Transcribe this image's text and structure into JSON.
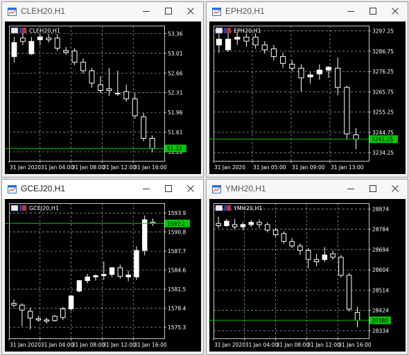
{
  "windows": [
    {
      "title": "CLEH20,H1",
      "active": false,
      "chart_label": "CLEH20,H1",
      "chart_data": {
        "type": "candlestick",
        "symbol": "CLEH20",
        "timeframe": "H1",
        "y_ticks": [
          "53.36",
          "53.01",
          "52.66",
          "52.31",
          "51.96",
          "51.61",
          "51.26"
        ],
        "ylim": [
          51.1,
          53.5
        ],
        "x_labels": [
          "31 Jan 2020",
          "31 Jan 04:00",
          "31 Jan 08:00",
          "31 Jan 12:00",
          "31 Jan 16:00"
        ],
        "current_price": "51.32",
        "candles": [
          {
            "o": 52.95,
            "h": 53.3,
            "l": 52.85,
            "c": 53.2
          },
          {
            "o": 53.28,
            "h": 53.38,
            "l": 53.15,
            "c": 53.22
          },
          {
            "o": 53.0,
            "h": 53.3,
            "l": 52.98,
            "c": 53.22
          },
          {
            "o": 53.25,
            "h": 53.36,
            "l": 53.15,
            "c": 53.3
          },
          {
            "o": 53.28,
            "h": 53.35,
            "l": 53.2,
            "c": 53.25
          },
          {
            "o": 53.28,
            "h": 53.35,
            "l": 53.05,
            "c": 53.1
          },
          {
            "o": 53.06,
            "h": 53.12,
            "l": 52.98,
            "c": 53.03
          },
          {
            "o": 53.05,
            "h": 53.1,
            "l": 52.8,
            "c": 52.85
          },
          {
            "o": 52.85,
            "h": 52.92,
            "l": 52.65,
            "c": 52.7
          },
          {
            "o": 52.7,
            "h": 52.75,
            "l": 52.4,
            "c": 52.48
          },
          {
            "o": 52.45,
            "h": 52.6,
            "l": 52.3,
            "c": 52.35
          },
          {
            "o": 52.38,
            "h": 52.75,
            "l": 52.25,
            "c": 52.35
          },
          {
            "o": 52.3,
            "h": 52.7,
            "l": 52.25,
            "c": 52.3
          },
          {
            "o": 52.33,
            "h": 52.45,
            "l": 52.15,
            "c": 52.2
          },
          {
            "o": 52.2,
            "h": 52.3,
            "l": 51.85,
            "c": 51.9
          },
          {
            "o": 51.88,
            "h": 51.95,
            "l": 51.45,
            "c": 51.5
          },
          {
            "o": 51.5,
            "h": 51.55,
            "l": 51.25,
            "c": 51.32
          }
        ]
      }
    },
    {
      "title": "EPH20,H1",
      "active": false,
      "chart_label": "EPH20,H1",
      "chart_data": {
        "type": "candlestick",
        "symbol": "EPH20",
        "timeframe": "H1",
        "y_ticks": [
          "3297.25",
          "3286.75",
          "3276.25",
          "3265.75",
          "3255.25",
          "3244.75",
          "3234.25"
        ],
        "ylim": [
          3230,
          3300
        ],
        "x_labels": [
          "31 Jan 2020",
          "31 Jan 05:00",
          "31 Jan 09:00",
          "31 Jan 13:00"
        ],
        "current_price": "3241.25",
        "candles": [
          {
            "o": 3290.0,
            "h": 3296.0,
            "l": 3286.0,
            "c": 3293.0
          },
          {
            "o": 3287.5,
            "h": 3296.0,
            "l": 3286.5,
            "c": 3293.0
          },
          {
            "o": 3293.0,
            "h": 3296.5,
            "l": 3290.0,
            "c": 3294.0
          },
          {
            "o": 3294.0,
            "h": 3296.0,
            "l": 3289.0,
            "c": 3292.0
          },
          {
            "o": 3294.0,
            "h": 3296.0,
            "l": 3288.0,
            "c": 3290.0
          },
          {
            "o": 3290.0,
            "h": 3292.0,
            "l": 3285.5,
            "c": 3287.5
          },
          {
            "o": 3288.0,
            "h": 3290.0,
            "l": 3282.0,
            "c": 3284.0
          },
          {
            "o": 3284.0,
            "h": 3286.0,
            "l": 3278.0,
            "c": 3280.5
          },
          {
            "o": 3280.0,
            "h": 3282.0,
            "l": 3276.5,
            "c": 3278.0
          },
          {
            "o": 3278.0,
            "h": 3280.0,
            "l": 3266.0,
            "c": 3273.0
          },
          {
            "o": 3273.5,
            "h": 3276.0,
            "l": 3270.0,
            "c": 3274.5
          },
          {
            "o": 3275.0,
            "h": 3280.0,
            "l": 3272.0,
            "c": 3277.0
          },
          {
            "o": 3277.0,
            "h": 3279.0,
            "l": 3273.0,
            "c": 3278.5
          },
          {
            "o": 3278.0,
            "h": 3283.5,
            "l": 3264.0,
            "c": 3268.0
          },
          {
            "o": 3268.0,
            "h": 3269.0,
            "l": 3241.0,
            "c": 3244.0
          },
          {
            "o": 3243.5,
            "h": 3247.0,
            "l": 3236.0,
            "c": 3241.25
          }
        ]
      }
    },
    {
      "title": "GCEJ20,H1",
      "active": true,
      "chart_label": "GCEJ20,H1",
      "chart_data": {
        "type": "candlestick",
        "symbol": "GCEJ20",
        "timeframe": "H1",
        "y_ticks": [
          "1593.9",
          "1590.8",
          "1587.7",
          "1584.6",
          "1581.5",
          "1578.4",
          "1575.3"
        ],
        "ylim": [
          1573.5,
          1595.5
        ],
        "x_labels": [
          "31 Jan 2020",
          "31 Jan 04:00",
          "31 Jan 08:00",
          "31 Jan 12:00",
          "31 Jan 16:00"
        ],
        "current_price": "1592.2",
        "candles": [
          {
            "o": 1579.2,
            "h": 1579.8,
            "l": 1578.6,
            "c": 1578.9
          },
          {
            "o": 1578.9,
            "h": 1579.2,
            "l": 1575.5,
            "c": 1578.1
          },
          {
            "o": 1577.9,
            "h": 1578.5,
            "l": 1575.0,
            "c": 1576.8
          },
          {
            "o": 1576.7,
            "h": 1577.1,
            "l": 1576.2,
            "c": 1576.5
          },
          {
            "o": 1576.5,
            "h": 1576.9,
            "l": 1575.9,
            "c": 1576.3
          },
          {
            "o": 1577.1,
            "h": 1577.3,
            "l": 1576.2,
            "c": 1576.4
          },
          {
            "o": 1578.3,
            "h": 1578.6,
            "l": 1576.5,
            "c": 1576.9
          },
          {
            "o": 1578.3,
            "h": 1580.5,
            "l": 1578.0,
            "c": 1580.4
          },
          {
            "o": 1581.2,
            "h": 1583.0,
            "l": 1581.0,
            "c": 1582.9
          },
          {
            "o": 1582.9,
            "h": 1584.0,
            "l": 1582.5,
            "c": 1583.5
          },
          {
            "o": 1583.5,
            "h": 1583.9,
            "l": 1582.9,
            "c": 1583.7
          },
          {
            "o": 1583.7,
            "h": 1586.0,
            "l": 1583.0,
            "c": 1583.9
          },
          {
            "o": 1583.9,
            "h": 1584.5,
            "l": 1583.5,
            "c": 1585.0
          },
          {
            "o": 1585.0,
            "h": 1585.5,
            "l": 1583.2,
            "c": 1583.6
          },
          {
            "o": 1583.5,
            "h": 1584.5,
            "l": 1582.8,
            "c": 1583.8
          },
          {
            "o": 1583.5,
            "h": 1588.5,
            "l": 1583.0,
            "c": 1587.8
          },
          {
            "o": 1587.8,
            "h": 1593.5,
            "l": 1587.0,
            "c": 1592.8
          },
          {
            "o": 1592.4,
            "h": 1593.0,
            "l": 1591.8,
            "c": 1592.2
          }
        ]
      }
    },
    {
      "title": "YMH20,H1",
      "active": false,
      "chart_label": "YMH20,H1",
      "chart_data": {
        "type": "candlestick",
        "symbol": "YMH20",
        "timeframe": "H1",
        "y_ticks": [
          "28874",
          "28784",
          "28694",
          "28604",
          "28514",
          "28424",
          "28334"
        ],
        "ylim": [
          28300,
          28900
        ],
        "x_labels": [
          "31 Jan 2020",
          "31 Jan 04:00",
          "31 Jan 08:00",
          "31 Jan 12:00",
          "31 Jan 16:00"
        ],
        "current_price": "28380",
        "candles": [
          {
            "o": 28810,
            "h": 28840,
            "l": 28790,
            "c": 28800
          },
          {
            "o": 28800,
            "h": 28830,
            "l": 28795,
            "c": 28820
          },
          {
            "o": 28805,
            "h": 28830,
            "l": 28785,
            "c": 28795
          },
          {
            "o": 28795,
            "h": 28815,
            "l": 28780,
            "c": 28805
          },
          {
            "o": 28805,
            "h": 28825,
            "l": 28795,
            "c": 28815
          },
          {
            "o": 28815,
            "h": 28828,
            "l": 28790,
            "c": 28805
          },
          {
            "o": 28805,
            "h": 28815,
            "l": 28770,
            "c": 28780
          },
          {
            "o": 28780,
            "h": 28790,
            "l": 28750,
            "c": 28760
          },
          {
            "o": 28765,
            "h": 28775,
            "l": 28720,
            "c": 28730
          },
          {
            "o": 28730,
            "h": 28745,
            "l": 28700,
            "c": 28710
          },
          {
            "o": 28710,
            "h": 28720,
            "l": 28670,
            "c": 28690
          },
          {
            "o": 28690,
            "h": 28700,
            "l": 28610,
            "c": 28650
          },
          {
            "o": 28650,
            "h": 28675,
            "l": 28620,
            "c": 28640
          },
          {
            "o": 28650,
            "h": 28705,
            "l": 28640,
            "c": 28670
          },
          {
            "o": 28675,
            "h": 28690,
            "l": 28650,
            "c": 28660
          },
          {
            "o": 28660,
            "h": 28670,
            "l": 28570,
            "c": 28580
          },
          {
            "o": 28580,
            "h": 28590,
            "l": 28420,
            "c": 28430
          },
          {
            "o": 28415,
            "h": 28440,
            "l": 28350,
            "c": 28380
          }
        ]
      }
    }
  ],
  "colors": {
    "background": "#000000",
    "grid": "#c8c8c8",
    "axis_text": "#ffffff",
    "bull_fill": "#ffffff",
    "bear_fill": "#000000",
    "price_line": "#00c800",
    "price_label_bg": "#00c800",
    "price_label_text": "#000000"
  },
  "icons": {
    "window": "chart-window-icon",
    "minimize": "minimize-icon",
    "maximize": "maximize-icon",
    "close": "close-icon",
    "flag": "symbol-flag-icon"
  }
}
